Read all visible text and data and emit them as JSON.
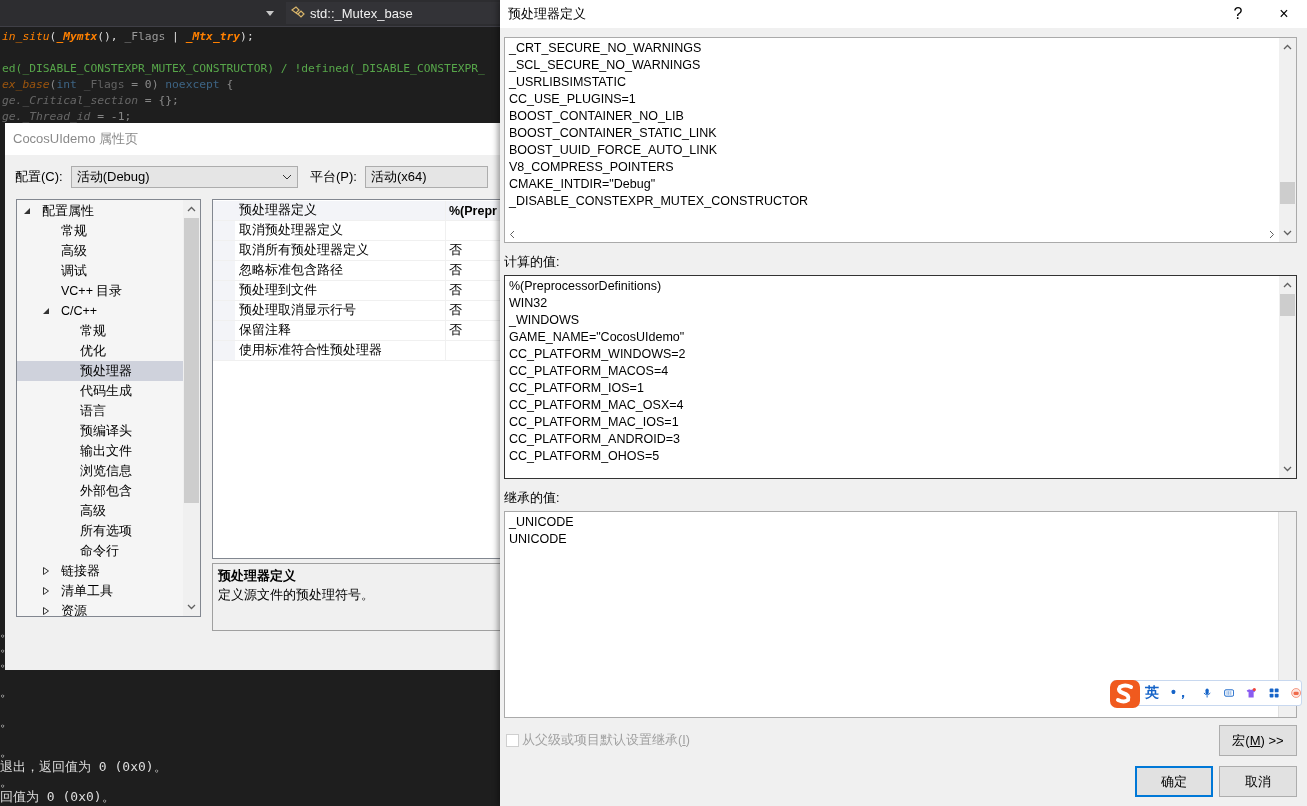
{
  "editor": {
    "nav_symbol": "std::_Mutex_base",
    "code_lines": [
      {
        "dim": false,
        "blank_after": true,
        "segments": [
          {
            "kind": "fn",
            "text": "in_situ"
          },
          {
            "kind": "plain",
            "text": "("
          },
          {
            "kind": "fnbold",
            "text": "_Mymtx"
          },
          {
            "kind": "plain",
            "text": "(), "
          },
          {
            "kind": "param",
            "text": "_Flags"
          },
          {
            "kind": "plain",
            "text": " | "
          },
          {
            "kind": "fnbold",
            "text": "_Mtx_try"
          },
          {
            "kind": "plain",
            "text": ");"
          }
        ]
      },
      {
        "dim": false,
        "blank_after": false,
        "segments": [
          {
            "kind": "preproc",
            "text": "ed(_DISABLE_CONSTEXPR_MUTEX_CONSTRUCTOR) / !defined(_DISABLE_CONSTEXPR_"
          }
        ]
      },
      {
        "dim": true,
        "blank_after": false,
        "segments": [
          {
            "kind": "fn",
            "text": "ex_base"
          },
          {
            "kind": "plain",
            "text": "("
          },
          {
            "kind": "keyword",
            "text": "int"
          },
          {
            "kind": "param",
            "text": " _Flags"
          },
          {
            "kind": "plain",
            "text": " = 0) "
          },
          {
            "kind": "keyword",
            "text": "noexcept"
          },
          {
            "kind": "plain",
            "text": " {"
          }
        ]
      },
      {
        "dim": true,
        "blank_after": false,
        "segments": [
          {
            "kind": "member",
            "text": "ge._Critical_section"
          },
          {
            "kind": "plain",
            "text": " = {};"
          }
        ]
      },
      {
        "dim": true,
        "blank_after": false,
        "segments": [
          {
            "kind": "member",
            "text": "ge._Thread_id"
          },
          {
            "kind": "plain",
            "text": "        = -1;"
          }
        ]
      }
    ],
    "output_lines": [
      {
        "text": "。",
        "blank_before": false
      },
      {
        "text": "。",
        "blank_before": false
      },
      {
        "text": "。",
        "blank_before": false
      },
      {
        "text": "。",
        "blank_before": true
      },
      {
        "text": "。",
        "blank_before": true
      },
      {
        "text": "。",
        "blank_before": true
      },
      {
        "text": "退出，返回值为 0 (0x0)。",
        "blank_before": false
      },
      {
        "text": "。",
        "blank_before": false
      },
      {
        "text": "回值为 0 (0x0)。",
        "blank_before": false
      }
    ]
  },
  "property_window": {
    "title": "CocosUIdemo 属性页",
    "config_label": "配置(C):",
    "config_value": "活动(Debug)",
    "platform_label": "平台(P):",
    "platform_value": "活动(x64)",
    "tree": [
      {
        "label": "配置属性",
        "kind": "folder",
        "expanded": true,
        "selected": false,
        "children": [
          {
            "label": "常规",
            "kind": "leaf",
            "selected": false
          },
          {
            "label": "高级",
            "kind": "leaf",
            "selected": false
          },
          {
            "label": "调试",
            "kind": "leaf",
            "selected": false
          },
          {
            "label": "VC++ 目录",
            "kind": "leaf",
            "selected": false
          },
          {
            "label": "C/C++",
            "kind": "folder",
            "expanded": true,
            "selected": false,
            "children": [
              {
                "label": "常规",
                "kind": "leaf",
                "selected": false
              },
              {
                "label": "优化",
                "kind": "leaf",
                "selected": false
              },
              {
                "label": "预处理器",
                "kind": "leaf",
                "selected": true
              },
              {
                "label": "代码生成",
                "kind": "leaf",
                "selected": false
              },
              {
                "label": "语言",
                "kind": "leaf",
                "selected": false
              },
              {
                "label": "预编译头",
                "kind": "leaf",
                "selected": false
              },
              {
                "label": "输出文件",
                "kind": "leaf",
                "selected": false
              },
              {
                "label": "浏览信息",
                "kind": "leaf",
                "selected": false
              },
              {
                "label": "外部包含",
                "kind": "leaf",
                "selected": false
              },
              {
                "label": "高级",
                "kind": "leaf",
                "selected": false
              },
              {
                "label": "所有选项",
                "kind": "leaf",
                "selected": false
              },
              {
                "label": "命令行",
                "kind": "leaf",
                "selected": false
              }
            ]
          },
          {
            "label": "链接器",
            "kind": "folder",
            "expanded": false,
            "selected": false
          },
          {
            "label": "清单工具",
            "kind": "folder",
            "expanded": false,
            "selected": false
          },
          {
            "label": "资源",
            "kind": "folder",
            "expanded": false,
            "selected": false
          }
        ]
      }
    ],
    "properties": [
      {
        "name": "预处理器定义",
        "value": "%(Prepr",
        "modified": true,
        "selected": true
      },
      {
        "name": "取消预处理器定义",
        "selected": false
      },
      {
        "name": "取消所有预处理器定义",
        "value": "否",
        "modified": false,
        "selected": false
      },
      {
        "name": "忽略标准包含路径",
        "value": "否",
        "modified": false,
        "selected": false
      },
      {
        "name": "预处理到文件",
        "value": "否",
        "modified": false,
        "selected": false
      },
      {
        "name": "预处理取消显示行号",
        "value": "否",
        "modified": false,
        "selected": false
      },
      {
        "name": "保留注释",
        "value": "否",
        "modified": false,
        "selected": false
      },
      {
        "name": "使用标准符合性预处理器",
        "selected": false
      }
    ],
    "description": {
      "title": "预处理器定义",
      "text": "定义源文件的预处理符号。"
    }
  },
  "dialog": {
    "title": "预处理器定义",
    "help": "?",
    "close": "×",
    "definitions": [
      "_CRT_SECURE_NO_WARNINGS",
      "_SCL_SECURE_NO_WARNINGS",
      "_USRLIBSIMSTATIC",
      "CC_USE_PLUGINS=1",
      "BOOST_CONTAINER_NO_LIB",
      "BOOST_CONTAINER_STATIC_LINK",
      "BOOST_UUID_FORCE_AUTO_LINK",
      "V8_COMPRESS_POINTERS",
      "CMAKE_INTDIR=\"Debug\"",
      "_DISABLE_CONSTEXPR_MUTEX_CONSTRUCTOR"
    ],
    "computed_label": "计算的值:",
    "computed": [
      "%(PreprocessorDefinitions)",
      "WIN32",
      "_WINDOWS",
      "GAME_NAME=\"CocosUIdemo\"",
      "CC_PLATFORM_WINDOWS=2",
      "CC_PLATFORM_MACOS=4",
      "CC_PLATFORM_IOS=1",
      "CC_PLATFORM_MAC_OSX=4",
      "CC_PLATFORM_MAC_IOS=1",
      "CC_PLATFORM_ANDROID=3",
      "CC_PLATFORM_OHOS=5"
    ],
    "inherited_label": "继承的值:",
    "inherited": [
      "_UNICODE",
      "UNICODE"
    ],
    "inherit_checkbox": {
      "before": "从父级或项目默认设置继承(",
      "mnemonic": "I",
      "after": ")",
      "checked": false,
      "disabled": true
    },
    "macro_button": {
      "before": "宏(",
      "mnemonic": "M",
      "after": ") >>"
    },
    "ok": "确定",
    "cancel": "取消",
    "ime": {
      "mode": "英",
      "punct": "•，"
    }
  }
}
